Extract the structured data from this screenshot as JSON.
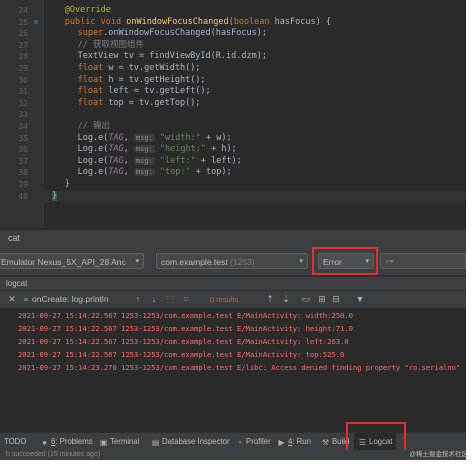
{
  "editor": {
    "lines": [
      {
        "num": "24",
        "html_kind": "annotation",
        "text": "@Override"
      },
      {
        "num": "25",
        "html_kind": "signature",
        "kw1": "public void ",
        "fn": "onWindowFocusChanged",
        "pre": "(",
        "kw2": "boolean ",
        "rest": "hasFocus) {"
      },
      {
        "num": "26",
        "html_kind": "super",
        "kw": "super",
        "rest": ".onWindowFocusChanged(hasFocus);"
      },
      {
        "num": "27",
        "html_kind": "comment",
        "text": "// 获取视图组件"
      },
      {
        "num": "28",
        "html_kind": "plain",
        "text": "TextView tv = findViewById(R.id.dzm);"
      },
      {
        "num": "29",
        "html_kind": "float",
        "kw": "float ",
        "rest": "w = tv.getWidth();"
      },
      {
        "num": "30",
        "html_kind": "float",
        "kw": "float ",
        "rest": "h = tv.getHeight();"
      },
      {
        "num": "31",
        "html_kind": "float",
        "kw": "float ",
        "rest": "left = tv.getLeft();"
      },
      {
        "num": "32",
        "html_kind": "float",
        "kw": "float ",
        "rest": "top = tv.getTop();"
      },
      {
        "num": "33",
        "html_kind": "blank",
        "text": ""
      },
      {
        "num": "34",
        "html_kind": "comment",
        "text": "// 输出"
      },
      {
        "num": "35",
        "html_kind": "log",
        "pre": "Log.e(",
        "tag": "TAG",
        "sep": ", ",
        "hint": "msg:",
        "str": "\"width:\"",
        "rest": " + w);"
      },
      {
        "num": "36",
        "html_kind": "log",
        "pre": "Log.e(",
        "tag": "TAG",
        "sep": ", ",
        "hint": "msg:",
        "str": "\"height:\"",
        "rest": " + h);"
      },
      {
        "num": "37",
        "html_kind": "log",
        "pre": "Log.e(",
        "tag": "TAG",
        "sep": ", ",
        "hint": "msg:",
        "str": "\"left:\"",
        "rest": " + left);"
      },
      {
        "num": "38",
        "html_kind": "log",
        "pre": "Log.e(",
        "tag": "TAG",
        "sep": ", ",
        "hint": "msg:",
        "str": "\"top:\"",
        "rest": " + top);"
      },
      {
        "num": "39",
        "html_kind": "plain",
        "text": "}"
      },
      {
        "num": "40",
        "html_kind": "brace",
        "text": "}"
      }
    ]
  },
  "logcat": {
    "title": "cat",
    "device": "Emulator Nexus_5X_API_28 Anc",
    "process": "com.example.test",
    "process_pid": "(1253)",
    "level": "Error",
    "search_icon": "search-icon",
    "subtitle": "logcat",
    "toolbar_label": "onCreate: log.println",
    "results": "0 results",
    "lines": [
      "2021-09-27 15:14:22.567 1253-1253/com.example.test E/MainActivity: width:250.0",
      "2021-09-27 15:14:22.567 1253-1253/com.example.test E/MainActivity: height:71.0",
      "2021-09-27 15:14:22.567 1253-1253/com.example.test E/MainActivity: left:263.0",
      "2021-09-27 15:14:22.567 1253-1253/com.example.test E/MainActivity: top:525.0",
      "2021-09-27 15:14:23.270 1253-1253/com.example.test E/libc: Access denied finding property \"ro.serialno\""
    ]
  },
  "bottombar": {
    "todo": "TODO",
    "problems_num": "6",
    "problems": ": Problems",
    "terminal": "Terminal",
    "db_inspector": "Database Inspector",
    "profiler": "Profiler",
    "run_num": "4",
    "run": ": Run",
    "build": "Build",
    "logcat": "Logcat"
  },
  "status": {
    "text": "h succeeded (15 minutes ago)",
    "watermark": "@稀土掘金技术社区"
  },
  "colors": {
    "error_red": "#ff6b68",
    "highlight_red": "#e0312c"
  }
}
